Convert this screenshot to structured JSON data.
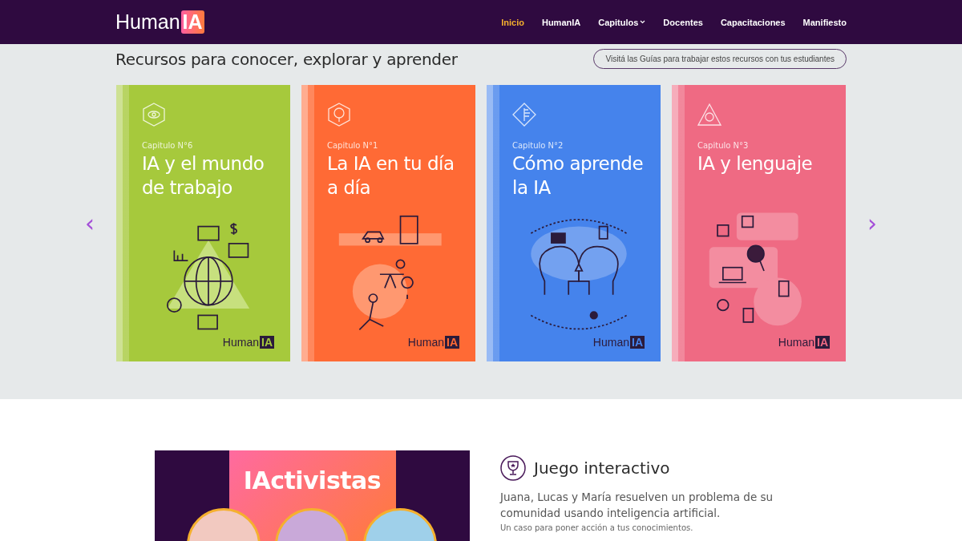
{
  "header": {
    "logo": {
      "text": "Human",
      "mark": "IA"
    },
    "nav": [
      {
        "label": "Inicio",
        "selected": true,
        "has_menu": false
      },
      {
        "label": "HumanIA",
        "selected": false,
        "has_menu": false
      },
      {
        "label": "Capitulos",
        "selected": false,
        "has_menu": true
      },
      {
        "label": "Docentes",
        "selected": false,
        "has_menu": false
      },
      {
        "label": "Capacitaciones",
        "selected": false,
        "has_menu": false
      },
      {
        "label": "Manifiesto",
        "selected": false,
        "has_menu": false
      }
    ]
  },
  "resources": {
    "title": "Recursos para conocer, explorar y aprender",
    "guide_button": "Visitá las Guías para trabajar estos recursos con tus estudiantes",
    "prev": "‹",
    "next": "›",
    "cards": [
      {
        "kind": "work",
        "color": "#a6c93c",
        "chapter": "Capitulo N°6",
        "title": "IA y el mundo de trabajo",
        "logo": "Human",
        "logo_mark": "IA"
      },
      {
        "kind": "daily",
        "color": "#ff6a35",
        "chapter": "Capitulo N°1",
        "title": "La IA en tu día a día",
        "logo": "Human",
        "logo_mark": "IA"
      },
      {
        "kind": "learn",
        "color": "#4583ec",
        "chapter": "Capitulo N°2",
        "title": "Cómo aprende la IA",
        "logo": "Human",
        "logo_mark": "IA"
      },
      {
        "kind": "language",
        "color": "#ef6a83",
        "chapter": "Capitulo N°3",
        "title": "IA y lenguaje",
        "logo": "Human",
        "logo_mark": "IA"
      }
    ]
  },
  "game": {
    "banner_title": "IActivistas",
    "heading": "Juego interactivo",
    "description": "Juana, Lucas y María resuelven un problema de su comunidad usando inteligencia artificial.",
    "subtitle": "Un caso para poner acción a tus conocimientos."
  }
}
